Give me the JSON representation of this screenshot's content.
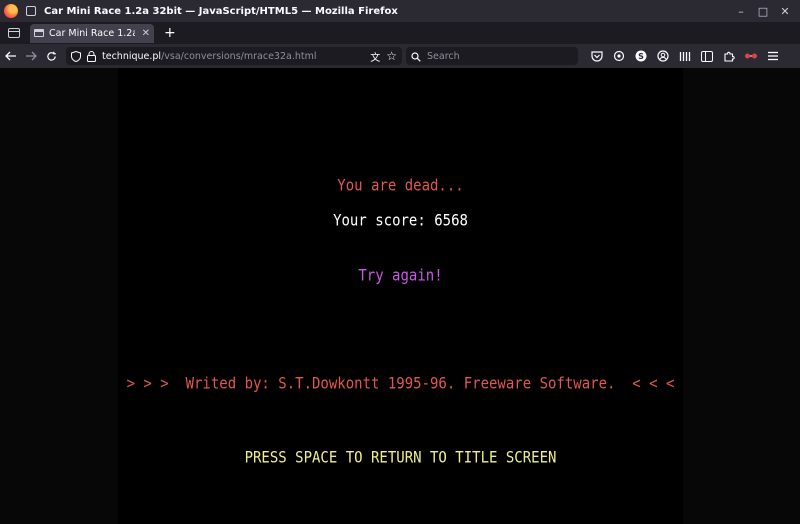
{
  "window": {
    "title": "Car Mini Race 1.2a 32bit — JavaScript/HTML5 — Mozilla Firefox",
    "controls": [
      "–",
      "□",
      "✕"
    ]
  },
  "tabs": [
    {
      "title": "Car Mini Race 1.2a 32bit",
      "close": "✕"
    }
  ],
  "newtab_label": "+",
  "nav": {
    "url_domain": "technique.pl",
    "url_path": "/vsa/conversions/mrace32a.html",
    "search_placeholder": "Search"
  },
  "game": {
    "dead_message": "You are dead...",
    "score_text": "Your score: 6568",
    "retry_text": "Try again!",
    "credits": "> > >  Writed by: S.T.Dowkontt 1995-96. Freeware Software.  < < <",
    "prompt": "PRESS SPACE TO RETURN TO TITLE SCREEN"
  },
  "colors": {
    "dead": "#e0584f",
    "score": "#ffffff",
    "retry": "#c85ae6",
    "credits": "#e0584f",
    "prompt": "#f0f08a"
  },
  "icons": [
    "firefox-logo",
    "window-icon",
    "tab-list-icon",
    "back-icon",
    "forward-icon",
    "reload-icon",
    "shield-icon",
    "lock-icon",
    "translate-icon",
    "bookmark-star-icon",
    "search-icon",
    "pocket-icon",
    "extension-icon",
    "account-icon",
    "library-icon",
    "menu-icon"
  ]
}
